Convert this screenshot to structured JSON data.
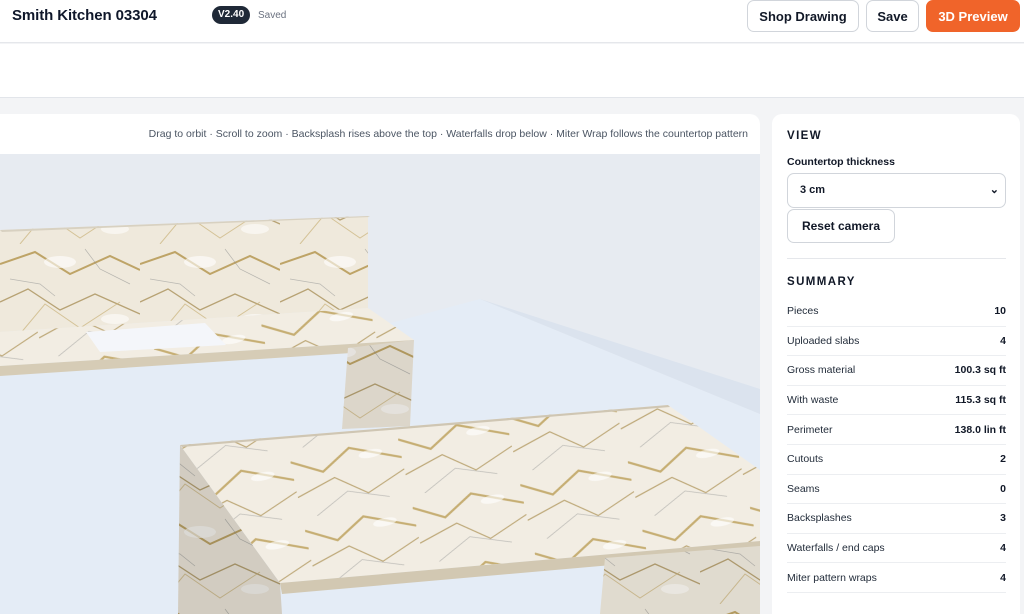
{
  "header": {
    "project_title": "Smith Kitchen 03304",
    "version_badge": "V2.40",
    "save_status": "Saved",
    "shop_drawing_label": "Shop Drawing",
    "save_label": "Save",
    "preview_label": "3D Preview"
  },
  "viewport": {
    "hint": "Drag to orbit · Scroll to zoom · Backsplash rises above the top · Waterfalls drop below · Miter Wrap follows the countertop pattern"
  },
  "panel": {
    "view_title": "VIEW",
    "thickness_label": "Countertop thickness",
    "thickness_value": "3 cm",
    "reset_label": "Reset camera",
    "summary_title": "SUMMARY",
    "summary": [
      {
        "label": "Pieces",
        "value": "10"
      },
      {
        "label": "Uploaded slabs",
        "value": "4"
      },
      {
        "label": "Gross material",
        "value": "100.3 sq ft"
      },
      {
        "label": "With waste",
        "value": "115.3 sq ft"
      },
      {
        "label": "Perimeter",
        "value": "138.0 lin ft"
      },
      {
        "label": "Cutouts",
        "value": "2"
      },
      {
        "label": "Seams",
        "value": "0"
      },
      {
        "label": "Backsplashes",
        "value": "3"
      },
      {
        "label": "Waterfalls / end caps",
        "value": "4"
      },
      {
        "label": "Miter pattern wraps",
        "value": "4"
      }
    ]
  },
  "colors": {
    "accent": "#f0642a",
    "badge": "#1f2937",
    "viewport_bg": "#e7ebf1",
    "floor": "#e4ecf6",
    "marble_base": "#efe9dc",
    "marble_vein": "#b59852"
  }
}
